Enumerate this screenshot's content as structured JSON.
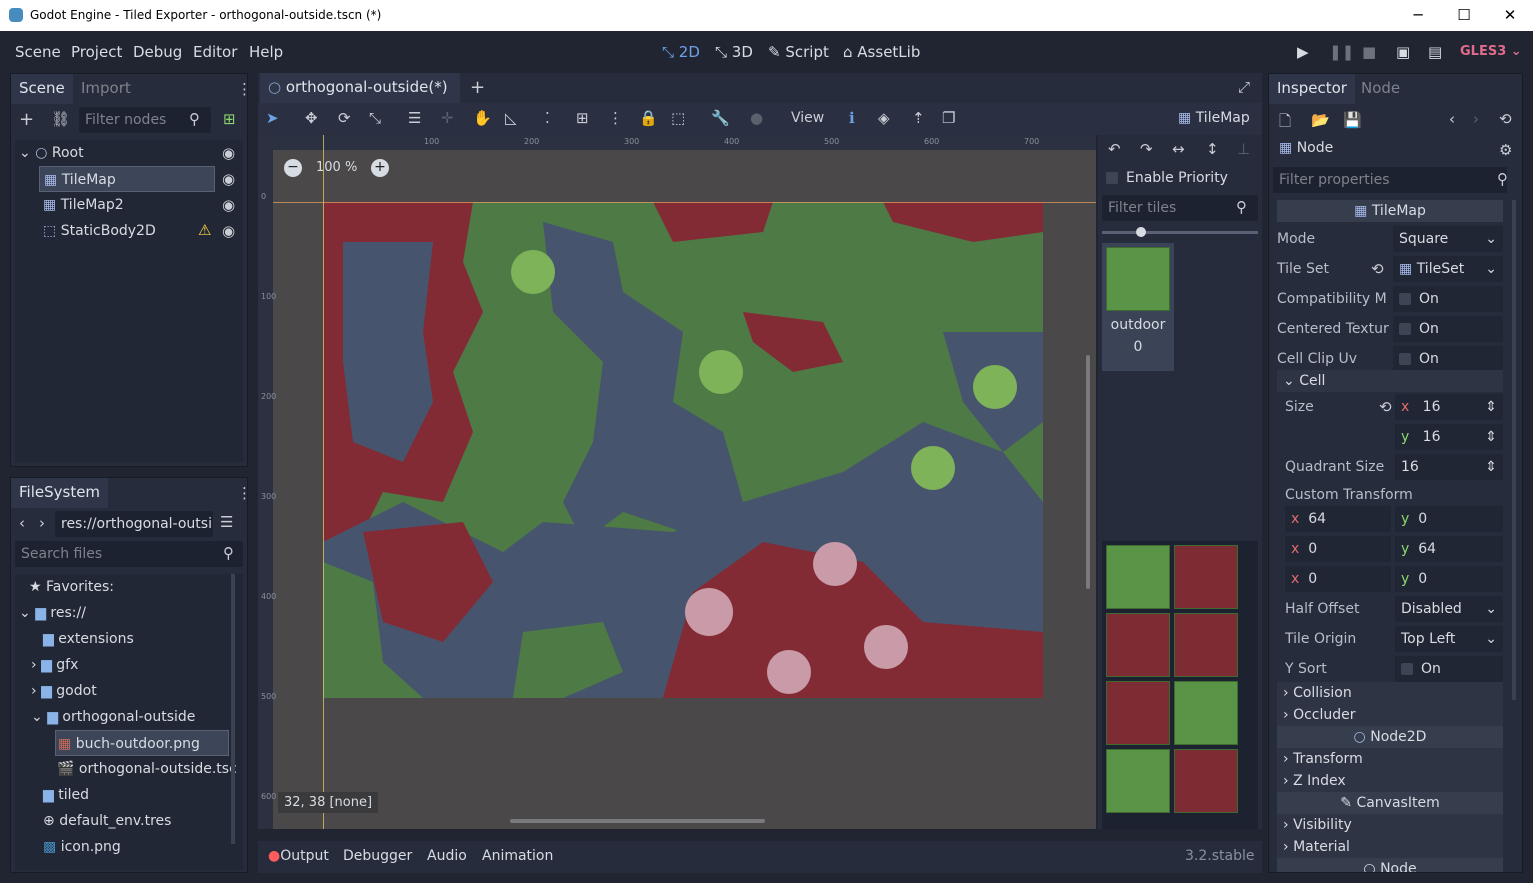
{
  "window": {
    "title": "Godot Engine - Tiled Exporter - orthogonal-outside.tscn (*)"
  },
  "menu": [
    "Scene",
    "Project",
    "Debug",
    "Editor",
    "Help"
  ],
  "workspaces": [
    "2D",
    "3D",
    "Script",
    "AssetLib"
  ],
  "renderer": "GLES3",
  "scene_dock": {
    "tabs": [
      "Scene",
      "Import"
    ],
    "filter_placeholder": "Filter nodes",
    "nodes": [
      {
        "label": "Root"
      },
      {
        "label": "TileMap"
      },
      {
        "label": "TileMap2"
      },
      {
        "label": "StaticBody2D"
      }
    ]
  },
  "filesystem": {
    "tab": "FileSystem",
    "path": "res://orthogonal-outsi",
    "search_placeholder": "Search files",
    "items": [
      {
        "label": "Favorites:"
      },
      {
        "label": "res://"
      },
      {
        "label": "extensions"
      },
      {
        "label": "gfx"
      },
      {
        "label": "godot"
      },
      {
        "label": "orthogonal-outside"
      },
      {
        "label": "buch-outdoor.png"
      },
      {
        "label": "orthogonal-outside.tsc"
      },
      {
        "label": "tiled"
      },
      {
        "label": "default_env.tres"
      },
      {
        "label": "icon.png"
      }
    ]
  },
  "editor": {
    "tab": "orthogonal-outside(*)",
    "zoom": "100 %",
    "view_label": "View",
    "node_label": "TileMap",
    "status": "32, 38 [none]",
    "ruler_ticks": [
      "100",
      "200",
      "300",
      "400",
      "500",
      "600",
      "700"
    ],
    "vruler_ticks": [
      "0",
      "100",
      "200",
      "300",
      "400",
      "500",
      "600"
    ]
  },
  "tile_palette": {
    "enable_priority": "Enable Priority",
    "filter_placeholder": "Filter tiles",
    "tileset_name": "outdoor",
    "tileset_index": "0"
  },
  "bottom": {
    "tabs": [
      "Output",
      "Debugger",
      "Audio",
      "Animation"
    ],
    "version": "3.2.stable"
  },
  "inspector": {
    "tabs": [
      "Inspector",
      "Node"
    ],
    "node": "Node",
    "filter_placeholder": "Filter properties",
    "section": "TileMap",
    "mode_label": "Mode",
    "mode": "Square",
    "tileset_label": "Tile Set",
    "tileset": "TileSet",
    "compat_label": "Compatibility M",
    "centered_label": "Centered Textur",
    "clip_label": "Cell Clip Uv",
    "on": "On",
    "cell_label": "Cell",
    "size_label": "Size",
    "size_x": "16",
    "size_y": "16",
    "quadrant_label": "Quadrant Size",
    "quadrant": "16",
    "custom_transform": "Custom Transform",
    "ct": [
      "64",
      "0",
      "0",
      "64",
      "0",
      "0"
    ],
    "half_offset_label": "Half Offset",
    "half_offset": "Disabled",
    "tile_origin_label": "Tile Origin",
    "tile_origin": "Top Left",
    "ysort_label": "Y Sort",
    "collision": "Collision",
    "occluder": "Occluder",
    "node2d": "Node2D",
    "transform": "Transform",
    "zindex": "Z Index",
    "canvasitem": "CanvasItem",
    "visibility": "Visibility",
    "material": "Material"
  }
}
